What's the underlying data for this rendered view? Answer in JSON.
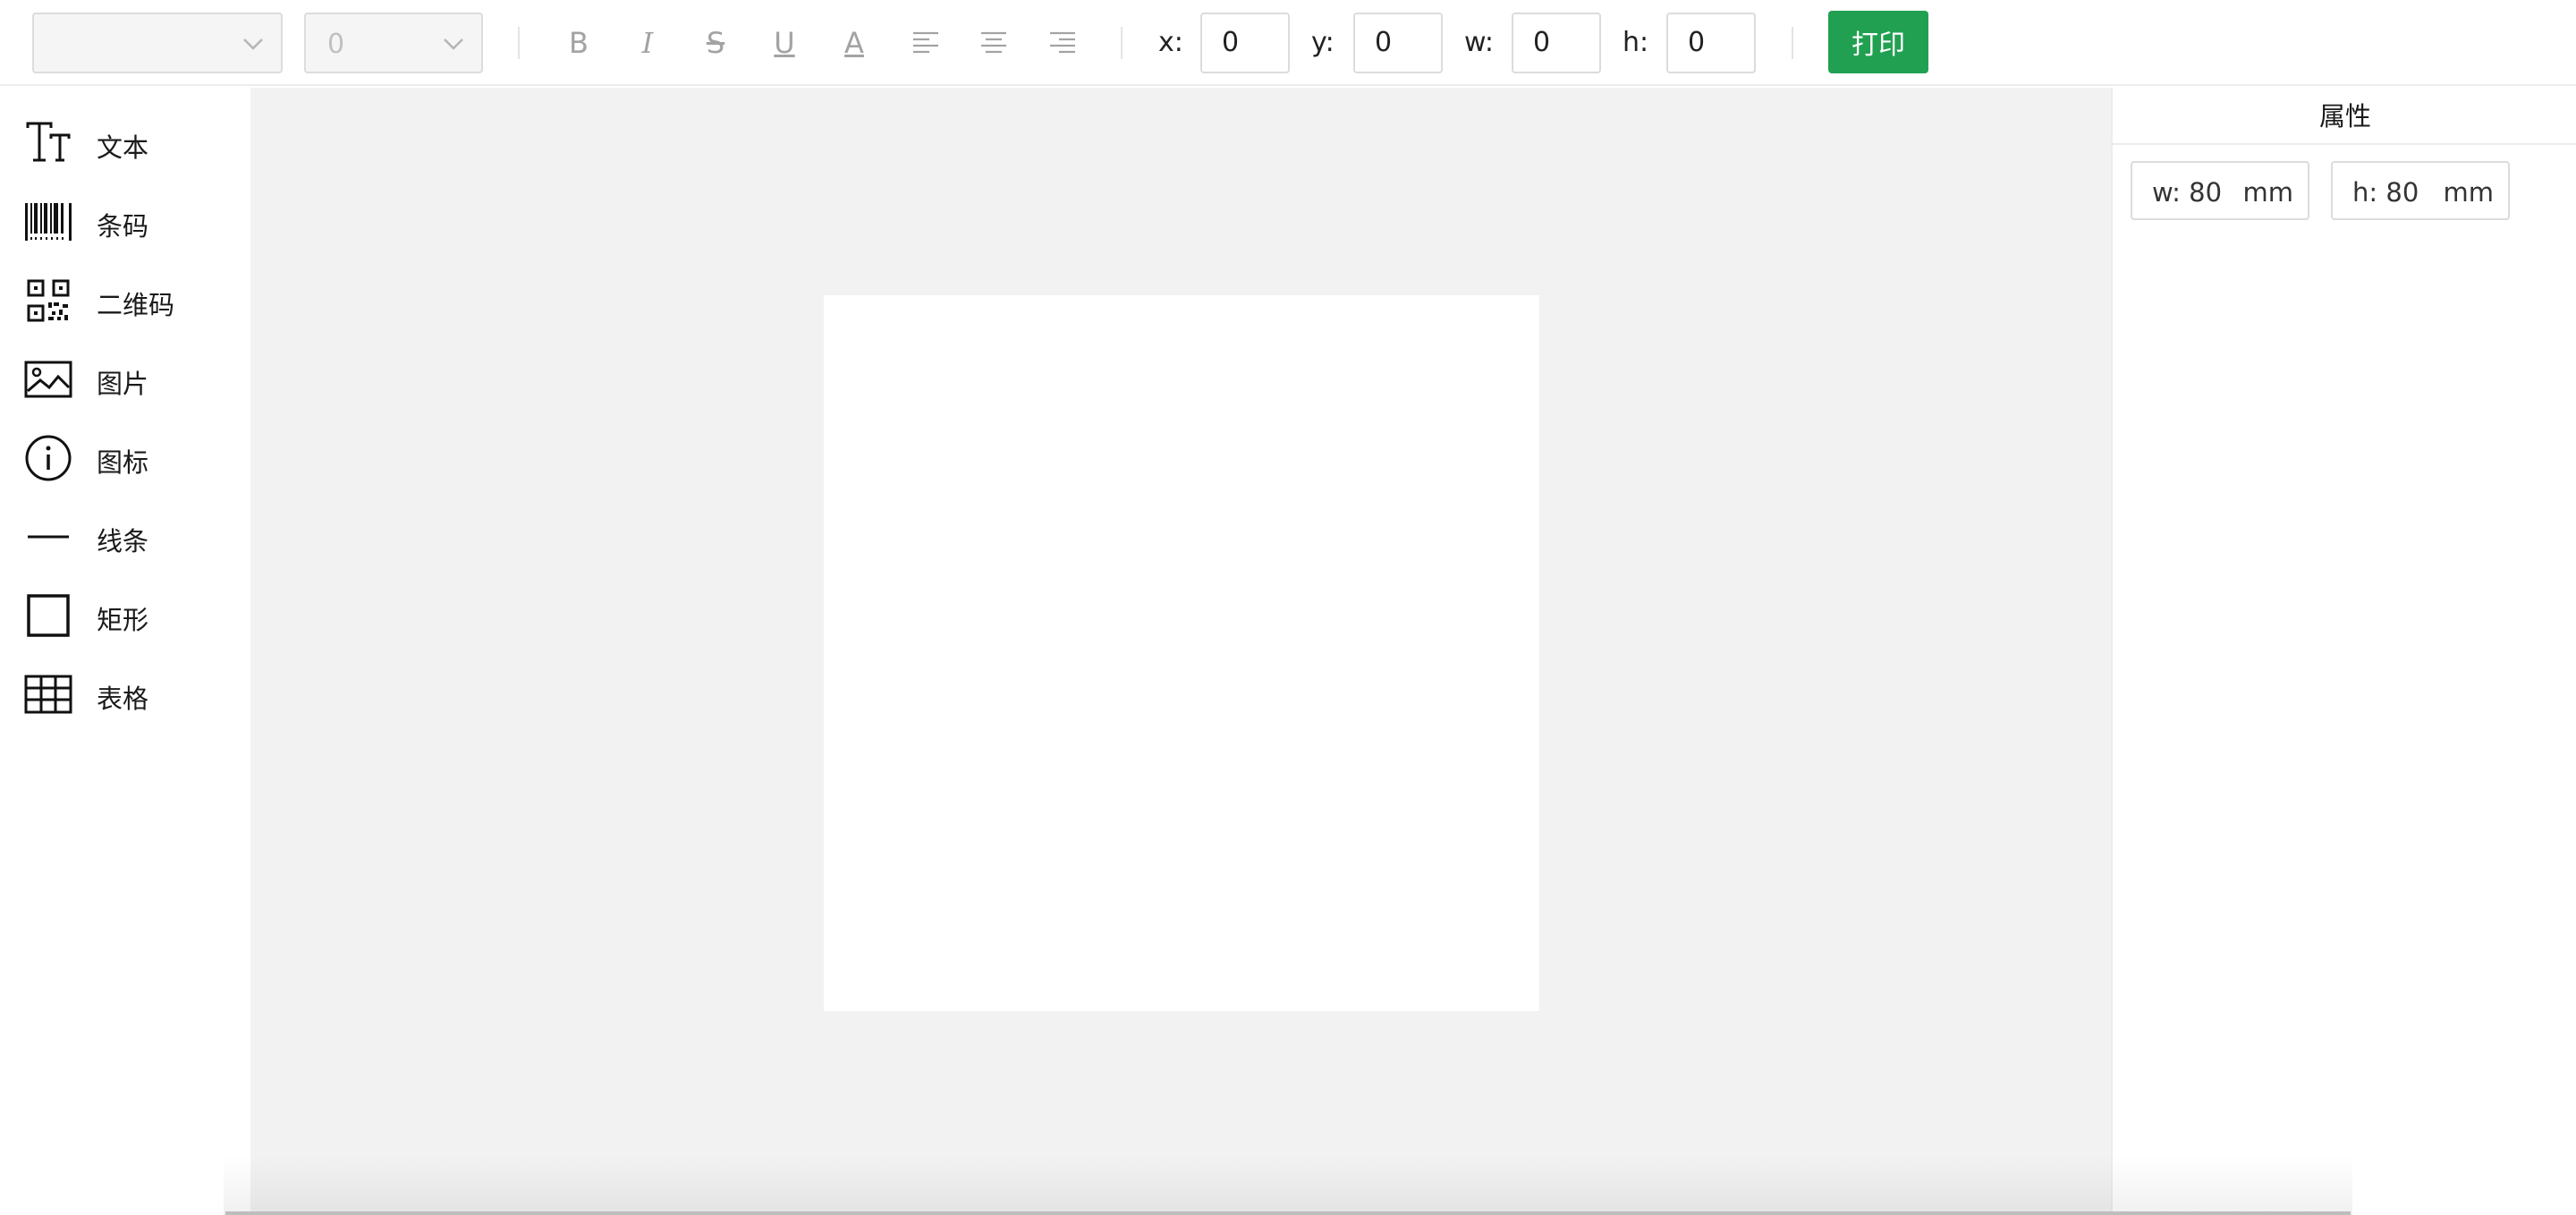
{
  "toolbar": {
    "font_family_value": "",
    "font_size_value": "0",
    "format_buttons": [
      {
        "name": "bold",
        "glyph": "B"
      },
      {
        "name": "italic",
        "glyph": "I"
      },
      {
        "name": "strikethrough",
        "glyph": "S"
      },
      {
        "name": "underline",
        "glyph": "U"
      },
      {
        "name": "text-color",
        "glyph": "A"
      },
      {
        "name": "align-left"
      },
      {
        "name": "align-center"
      },
      {
        "name": "align-right"
      }
    ],
    "x_label": "x:",
    "x_value": "0",
    "y_label": "y:",
    "y_value": "0",
    "w_label": "w:",
    "w_value": "0",
    "h_label": "h:",
    "h_value": "0",
    "print_label": "打印"
  },
  "palette": {
    "items": [
      {
        "label": "文本",
        "icon": "text-icon"
      },
      {
        "label": "条码",
        "icon": "barcode-icon"
      },
      {
        "label": "二维码",
        "icon": "qrcode-icon"
      },
      {
        "label": "图片",
        "icon": "image-icon"
      },
      {
        "label": "图标",
        "icon": "info-icon"
      },
      {
        "label": "线条",
        "icon": "line-icon"
      },
      {
        "label": "矩形",
        "icon": "rectangle-icon"
      },
      {
        "label": "表格",
        "icon": "table-icon"
      }
    ]
  },
  "properties": {
    "title": "属性",
    "width": {
      "value": "w: 80",
      "unit": "mm"
    },
    "height": {
      "value": "h: 80",
      "unit": "mm"
    }
  },
  "colors": {
    "accent": "#22a052",
    "canvas_bg": "#f2f2f2",
    "disabled_icon": "#a3a3a3"
  }
}
